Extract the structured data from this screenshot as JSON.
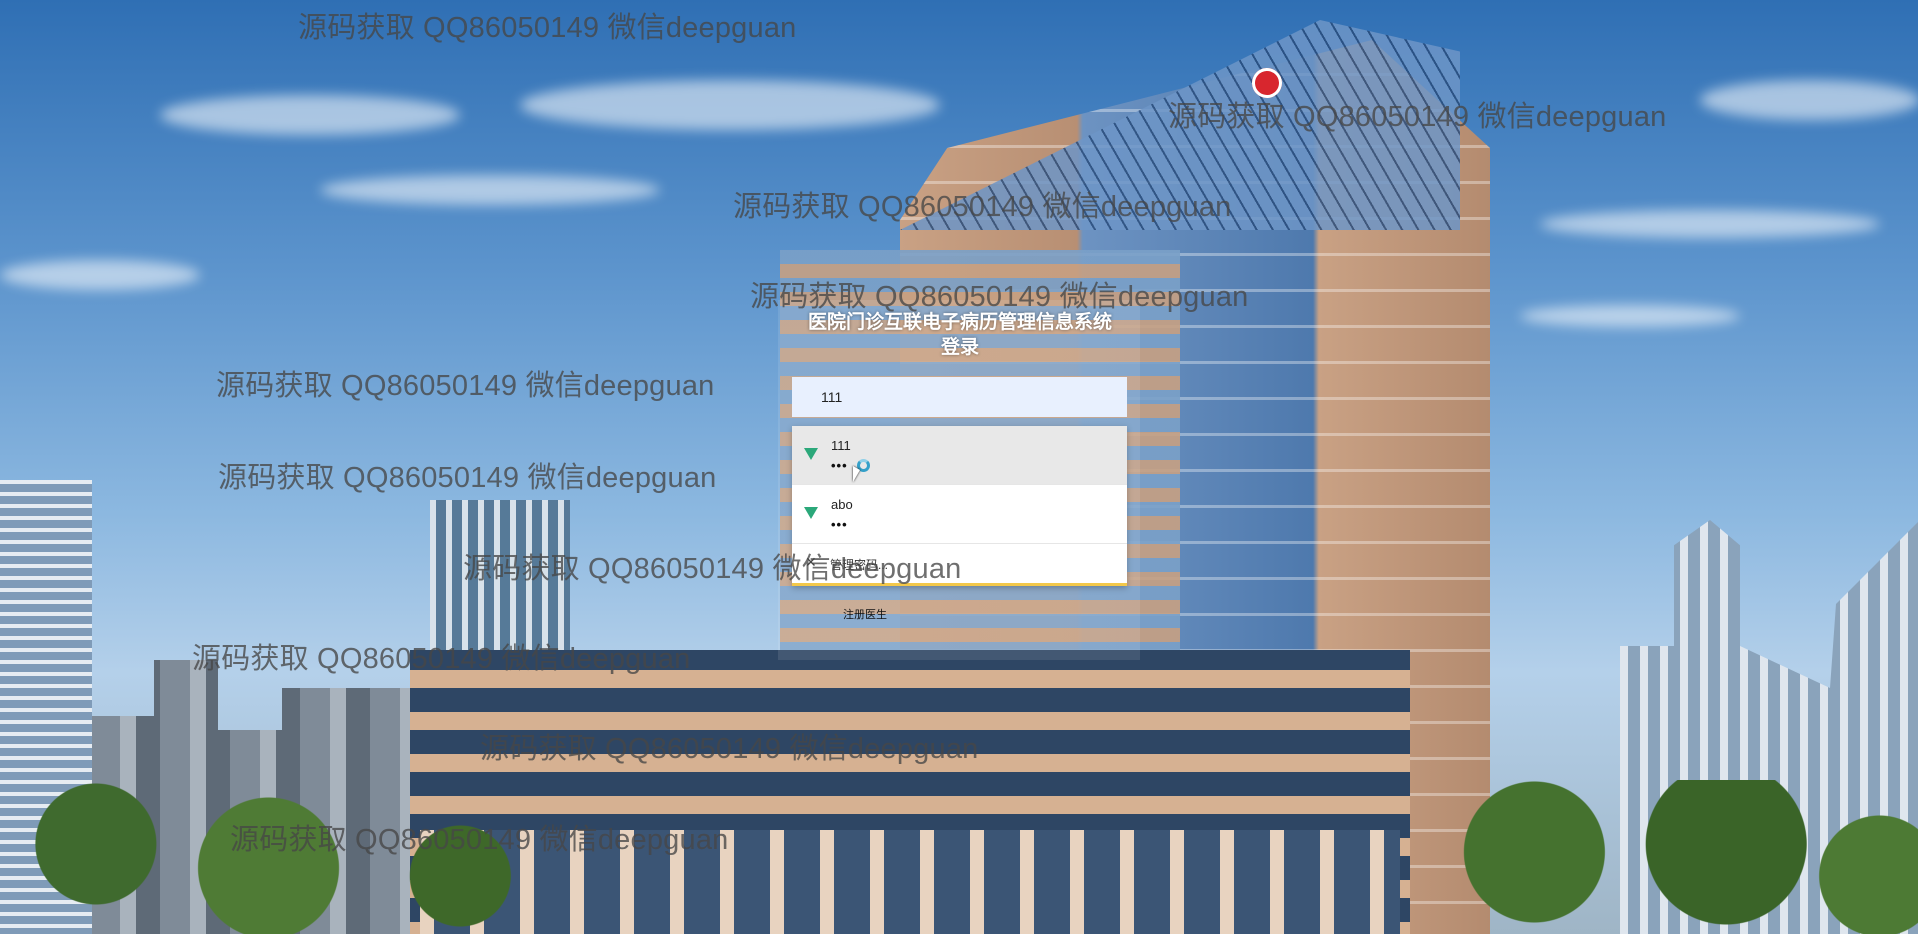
{
  "page": {
    "title": "医院门诊互联电子病历管理信息系统",
    "subtitle": "登录"
  },
  "login": {
    "username_value": "111",
    "register_label": "注册医生"
  },
  "autofill": {
    "suggestions": [
      {
        "username": "111",
        "password": "•••"
      },
      {
        "username": "abo",
        "password": "•••"
      }
    ],
    "manage_label": "管理密码..."
  },
  "watermarks": [
    "源码获取 QQ86050149 微信deepguan",
    "源码获取 QQ86050149 微信deepguan",
    "源码获取 QQ86050149 微信deepguan",
    "源码获取 QQ86050149 微信deepguan",
    "源码获取 QQ86050149 微信deepguan",
    "源码获取 QQ86050149 微信deepguan",
    "源码获取 QQ86050149 微信deepguan",
    "源码获取 QQ86050149 微信deepguan",
    "源码获取 QQ86050149 微信deepguan",
    "源码获取 QQ86050149 微信deepguan"
  ],
  "colors": {
    "sky": "#5b93cc",
    "field_bg": "#e8f0fe",
    "autofill_accent": "#f3c84a",
    "key_icon": "#2ba87a"
  }
}
